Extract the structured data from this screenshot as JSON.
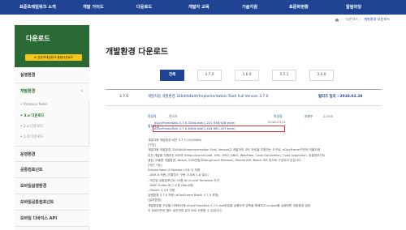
{
  "nav": {
    "items": [
      "표준프레임워크 소개",
      "개발 가이드",
      "다운로드",
      "개발자 교육",
      "기술지원",
      "표준화현황",
      "알림마당"
    ]
  },
  "breadcrumb": [
    "다운로드",
    "개발환경 다운로드"
  ],
  "sidebar": {
    "title": "다운로드",
    "banner": "★ 표준프레임워크 통합다운로드",
    "items": {
      "runtime": "실행환경",
      "devenv": "개발환경",
      "ops": "운영환경",
      "common": "공통컴포넌트",
      "mobile_runtime": "모바일실행환경",
      "mobile_common": "모바일공통컴포넌트",
      "mobile_device": "모바일 디바이스 API"
    },
    "subitems": [
      "Release Note",
      "3.x 다운로드",
      "2.x 다운로드",
      "1.0 다운로드"
    ]
  },
  "main": {
    "title": "개발환경 다운로드",
    "tabs": [
      "전체",
      "3.7.0",
      "3.6.0",
      "3.5.1",
      "3.2.0"
    ],
    "row": {
      "version": "3.7.0",
      "title": "개발자용 개발환경 32bit(64bit)(Implementation Tool) Full Version 3.7.0",
      "release_label": "릴리즈 일자 : 2018.02.28"
    },
    "detail": {
      "author_label": "작성자",
      "author": "관리자",
      "date_label": "작성일",
      "date": "2018-03-21",
      "views_label": "조회수",
      "views": "22355",
      "attach_label": "첨부파일",
      "file1": "eGovFrameDev-3.7.0-32bit.exe(1,221,938,928 byte)",
      "file2": "eGovFrameDev-3.7.0-64bit.exe(1,444,961,257 byte)"
    },
    "description": [
      "개발자용 개발환경 버전 3.7.0 (32/64bit)",
      "[구성]",
      "개발자용 개발환경 32/64bit(Implementation Tool) Version은 개발자의 코드 작성을 지원하는 도구로, eGovFrame기반의 어플리케",
      "이션 개발을 지원하는 IDE와 Editor(SourceCode, UML, ERD, DBIO, WebFlow, Code Generation, Code Inspection, 공통컴포넌트",
      "생성, 모듈형 개발환경, Nexus, SVN연동/Debug/Local Remote), Mobile IDE, Batch IDE 등으로 구성되어 있습니다.",
      "[개선 기능]",
      "Eclipse Neon.3 Release (4.6.3) 적용",
      "- JAVA 8 적용 (이클립스 구동 시 JDK 1.8 필수)",
      "- 개선된 공통컴포넌트 55종 All-in-one Template 추가",
      "- DBIO Editor 버그 수정 (Bank형)",
      "- Maven 3.3.9 적용",
      "실행환경 3.7.0 적용 (eGovFrame Batch 3.7.0 포함)",
      "[설치방법]",
      "개발환경을 구성할 디렉토리에 eGovFrameDev 3.7.0 exe파일을 실행하여 압축을 해제하고 eclipse를 실행하면 개발환경 설정",
      "이 완료되므로 별도 설치과정 없이 바로 사용할 수 있습니다."
    ]
  }
}
